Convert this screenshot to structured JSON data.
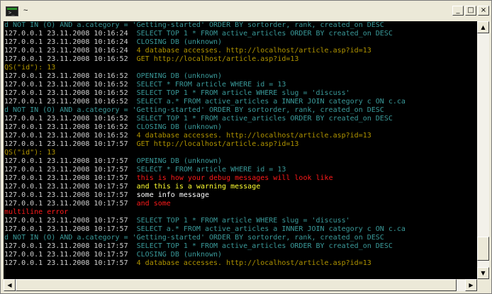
{
  "window": {
    "title": "~",
    "minimize_glyph": "_",
    "maximize_glyph": "□",
    "close_glyph": "×",
    "app_icon": "console-icon",
    "app_icon_prompt": ">_"
  },
  "scrollbars": {
    "up_glyph": "▲",
    "down_glyph": "▼",
    "left_glyph": "◀",
    "right_glyph": "▶",
    "vertical_position": 0.97,
    "horizontal_position": 0.0
  },
  "colors": {
    "plain": "#d0d0d0",
    "teal": "#3a9a9a",
    "olive": "#b09400",
    "red": "#ff1a1a",
    "yellow": "#ffff30",
    "white": "#ffffff"
  },
  "console": [
    {
      "segs": [
        {
          "t": "d NOT IN (O) AND a.category = 'Getting-started' ORDER BY sortorder, rank, created_on DESC",
          "c": "teal"
        }
      ]
    },
    {
      "segs": [
        {
          "t": "127.0.0.1 23.11.2008 10:16:24  ",
          "c": "plain"
        },
        {
          "t": "SELECT TOP 1 * FROM active_articles ORDER BY created_on DESC",
          "c": "teal"
        }
      ]
    },
    {
      "segs": [
        {
          "t": "127.0.0.1 23.11.2008 10:16:24  ",
          "c": "plain"
        },
        {
          "t": "CLOSING DB (unknown)",
          "c": "teal"
        }
      ]
    },
    {
      "segs": [
        {
          "t": "127.0.0.1 23.11.2008 10:16:24  ",
          "c": "plain"
        },
        {
          "t": "4 database accesses. http://localhost/article.asp?id=13",
          "c": "olive"
        }
      ]
    },
    {
      "segs": [
        {
          "t": "127.0.0.1 23.11.2008 10:16:52  ",
          "c": "plain"
        },
        {
          "t": "GET http://localhost/article.asp?id=13",
          "c": "olive"
        }
      ]
    },
    {
      "segs": [
        {
          "t": "QS(\"id\"): 13",
          "c": "olive"
        }
      ]
    },
    {
      "segs": [
        {
          "t": "127.0.0.1 23.11.2008 10:16:52  ",
          "c": "plain"
        },
        {
          "t": "OPENING DB (unknown)",
          "c": "teal"
        }
      ]
    },
    {
      "segs": [
        {
          "t": "127.0.0.1 23.11.2008 10:16:52  ",
          "c": "plain"
        },
        {
          "t": "SELECT * FROM article WHERE id = 13",
          "c": "teal"
        }
      ]
    },
    {
      "segs": [
        {
          "t": "127.0.0.1 23.11.2008 10:16:52  ",
          "c": "plain"
        },
        {
          "t": "SELECT TOP 1 * FROM article WHERE slug = 'discuss'",
          "c": "teal"
        }
      ]
    },
    {
      "segs": [
        {
          "t": "127.0.0.1 23.11.2008 10:16:52  ",
          "c": "plain"
        },
        {
          "t": "SELECT a.* FROM active_articles a INNER JOIN category c ON c.ca",
          "c": "teal"
        }
      ]
    },
    {
      "segs": [
        {
          "t": "d NOT IN (O) AND a.category = 'Getting-started' ORDER BY sortorder, rank, created_on DESC",
          "c": "teal"
        }
      ]
    },
    {
      "segs": [
        {
          "t": "127.0.0.1 23.11.2008 10:16:52  ",
          "c": "plain"
        },
        {
          "t": "SELECT TOP 1 * FROM active_articles ORDER BY created_on DESC",
          "c": "teal"
        }
      ]
    },
    {
      "segs": [
        {
          "t": "127.0.0.1 23.11.2008 10:16:52  ",
          "c": "plain"
        },
        {
          "t": "CLOSING DB (unknown)",
          "c": "teal"
        }
      ]
    },
    {
      "segs": [
        {
          "t": "127.0.0.1 23.11.2008 10:16:52  ",
          "c": "plain"
        },
        {
          "t": "4 database accesses. http://localhost/article.asp?id=13",
          "c": "olive"
        }
      ]
    },
    {
      "segs": [
        {
          "t": "127.0.0.1 23.11.2008 10:17:57  ",
          "c": "plain"
        },
        {
          "t": "GET http://localhost/article.asp?id=13",
          "c": "olive"
        }
      ]
    },
    {
      "segs": [
        {
          "t": "QS(\"id\"): 13",
          "c": "olive"
        }
      ]
    },
    {
      "segs": [
        {
          "t": "127.0.0.1 23.11.2008 10:17:57  ",
          "c": "plain"
        },
        {
          "t": "OPENING DB (unknown)",
          "c": "teal"
        }
      ]
    },
    {
      "segs": [
        {
          "t": "127.0.0.1 23.11.2008 10:17:57  ",
          "c": "plain"
        },
        {
          "t": "SELECT * FROM article WHERE id = 13",
          "c": "teal"
        }
      ]
    },
    {
      "segs": [
        {
          "t": "127.0.0.1 23.11.2008 10:17:57  ",
          "c": "plain"
        },
        {
          "t": "this is how your debug messages will look like",
          "c": "red"
        }
      ]
    },
    {
      "segs": [
        {
          "t": "127.0.0.1 23.11.2008 10:17:57  ",
          "c": "plain"
        },
        {
          "t": "and this is a warning message",
          "c": "yellow"
        }
      ]
    },
    {
      "segs": [
        {
          "t": "127.0.0.1 23.11.2008 10:17:57  ",
          "c": "plain"
        },
        {
          "t": "some info message",
          "c": "white"
        }
      ]
    },
    {
      "segs": [
        {
          "t": "127.0.0.1 23.11.2008 10:17:57  ",
          "c": "plain"
        },
        {
          "t": "and some",
          "c": "red"
        }
      ]
    },
    {
      "segs": [
        {
          "t": "multiline error",
          "c": "red"
        }
      ]
    },
    {
      "segs": [
        {
          "t": "127.0.0.1 23.11.2008 10:17:57  ",
          "c": "plain"
        },
        {
          "t": "SELECT TOP 1 * FROM article WHERE slug = 'discuss'",
          "c": "teal"
        }
      ]
    },
    {
      "segs": [
        {
          "t": "127.0.0.1 23.11.2008 10:17:57  ",
          "c": "plain"
        },
        {
          "t": "SELECT a.* FROM active_articles a INNER JOIN category c ON c.ca",
          "c": "teal"
        }
      ]
    },
    {
      "segs": [
        {
          "t": "d NOT IN (O) AND a.category = 'Getting-started' ORDER BY sortorder, rank, created_on DESC",
          "c": "teal"
        }
      ]
    },
    {
      "segs": [
        {
          "t": "127.0.0.1 23.11.2008 10:17:57  ",
          "c": "plain"
        },
        {
          "t": "SELECT TOP 1 * FROM active_articles ORDER BY created_on DESC",
          "c": "teal"
        }
      ]
    },
    {
      "segs": [
        {
          "t": "127.0.0.1 23.11.2008 10:17:57  ",
          "c": "plain"
        },
        {
          "t": "CLOSING DB (unknown)",
          "c": "teal"
        }
      ]
    },
    {
      "segs": [
        {
          "t": "127.0.0.1 23.11.2008 10:17:57  ",
          "c": "plain"
        },
        {
          "t": "4 database accesses. http://localhost/article.asp?id=13",
          "c": "olive"
        }
      ]
    }
  ]
}
